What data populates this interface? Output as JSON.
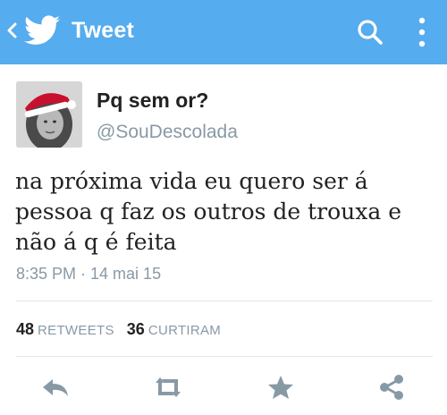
{
  "header": {
    "title": "Tweet",
    "back_icon": "chevron-left-icon",
    "logo_icon": "twitter-bird-icon",
    "search_icon": "search-icon",
    "more_icon": "more-vertical-icon",
    "bar_color": "#55acee"
  },
  "tweet": {
    "author_name": "Pq sem or?",
    "author_handle": "@SouDescolada",
    "text": "na próxima vida eu quero ser á\npessoa q faz os outros de trouxa e\nnão á q é feita",
    "timestamp": "8:35 PM · 14 mai 15"
  },
  "stats": {
    "retweets_count": "48",
    "retweets_label": "RETWEETS",
    "likes_count": "36",
    "likes_label": "CURTIRAM"
  },
  "actions": [
    {
      "icon": "reply-icon"
    },
    {
      "icon": "retweet-icon"
    },
    {
      "icon": "star-icon"
    },
    {
      "icon": "share-icon"
    }
  ]
}
